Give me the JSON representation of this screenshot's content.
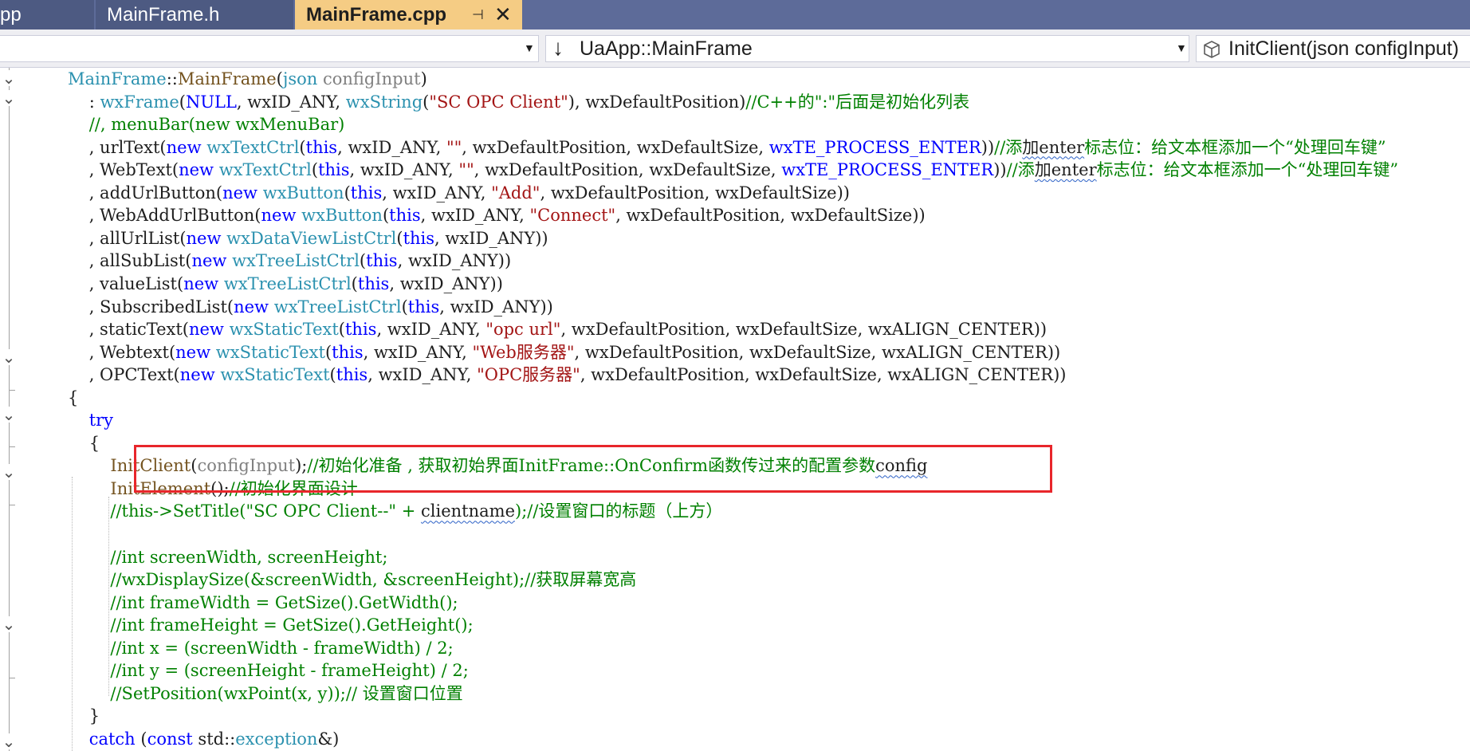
{
  "tabs": [
    {
      "label": "pp",
      "active": false
    },
    {
      "label": "MainFrame.h",
      "active": false
    },
    {
      "label": "MainFrame.cpp",
      "active": true
    }
  ],
  "tab_icons": {
    "pin": "pin-icon",
    "close": "close-icon"
  },
  "nav": {
    "scope_value": "",
    "type_value": "UaApp::MainFrame",
    "member_value": "InitClient(json configInput)"
  },
  "colors": {
    "tab_bar": "#5d6b99",
    "active_tab": "#f5cc84",
    "keyword": "#0000ff",
    "type": "#2b91af",
    "function": "#74531f",
    "string": "#a31515",
    "comment": "#008000",
    "highlight_box": "#e8262b"
  },
  "code_lines": [
    [
      [
        "t",
        "MainFrame"
      ],
      [
        "n",
        "::"
      ],
      [
        "m",
        "MainFrame"
      ],
      [
        "n",
        "("
      ],
      [
        "t",
        "json"
      ],
      [
        "n",
        " "
      ],
      [
        "p",
        "configInput"
      ],
      [
        "n",
        ")"
      ]
    ],
    [
      [
        "n",
        "    : "
      ],
      [
        "t",
        "wxFrame"
      ],
      [
        "n",
        "("
      ],
      [
        "k",
        "NULL"
      ],
      [
        "n",
        ", wxID_ANY, "
      ],
      [
        "t",
        "wxString"
      ],
      [
        "n",
        "("
      ],
      [
        "s",
        "\"SC OPC Client\""
      ],
      [
        "n",
        "), wxDefaultPosition)"
      ],
      [
        "c",
        "//C++的\":\"后面是初始化列表"
      ]
    ],
    [
      [
        "c",
        "    //, menuBar(new wxMenuBar)"
      ]
    ],
    [
      [
        "n",
        "    , urlText("
      ],
      [
        "k",
        "new"
      ],
      [
        "n",
        " "
      ],
      [
        "t",
        "wxTextCtrl"
      ],
      [
        "n",
        "("
      ],
      [
        "k",
        "this"
      ],
      [
        "n",
        ", wxID_ANY, "
      ],
      [
        "s",
        "\"\""
      ],
      [
        "n",
        ", wxDefaultPosition, wxDefaultSize, "
      ],
      [
        "k",
        "wxTE_PROCESS_ENTER"
      ],
      [
        "n",
        "))"
      ],
      [
        "c",
        "//添"
      ],
      [
        "sqc",
        "加enter"
      ],
      [
        "c",
        "标志位：给文本框添加一个“处理回车键”"
      ]
    ],
    [
      [
        "n",
        "    , WebText("
      ],
      [
        "k",
        "new"
      ],
      [
        "n",
        " "
      ],
      [
        "t",
        "wxTextCtrl"
      ],
      [
        "n",
        "("
      ],
      [
        "k",
        "this"
      ],
      [
        "n",
        ", wxID_ANY, "
      ],
      [
        "s",
        "\"\""
      ],
      [
        "n",
        ", wxDefaultPosition, wxDefaultSize, "
      ],
      [
        "k",
        "wxTE_PROCESS_ENTER"
      ],
      [
        "n",
        "))"
      ],
      [
        "c",
        "//添"
      ],
      [
        "sqc",
        "加enter"
      ],
      [
        "c",
        "标志位：给文本框添加一个“处理回车键”"
      ]
    ],
    [
      [
        "n",
        "    , addUrlButton("
      ],
      [
        "k",
        "new"
      ],
      [
        "n",
        " "
      ],
      [
        "t",
        "wxButton"
      ],
      [
        "n",
        "("
      ],
      [
        "k",
        "this"
      ],
      [
        "n",
        ", wxID_ANY, "
      ],
      [
        "s",
        "\"Add\""
      ],
      [
        "n",
        ", wxDefaultPosition, wxDefaultSize))"
      ]
    ],
    [
      [
        "n",
        "    , WebAddUrlButton("
      ],
      [
        "k",
        "new"
      ],
      [
        "n",
        " "
      ],
      [
        "t",
        "wxButton"
      ],
      [
        "n",
        "("
      ],
      [
        "k",
        "this"
      ],
      [
        "n",
        ", wxID_ANY, "
      ],
      [
        "s",
        "\"Connect\""
      ],
      [
        "n",
        ", wxDefaultPosition, wxDefaultSize))"
      ]
    ],
    [
      [
        "n",
        "    , allUrlList("
      ],
      [
        "k",
        "new"
      ],
      [
        "n",
        " "
      ],
      [
        "t",
        "wxDataViewListCtrl"
      ],
      [
        "n",
        "("
      ],
      [
        "k",
        "this"
      ],
      [
        "n",
        ", wxID_ANY))"
      ]
    ],
    [
      [
        "n",
        "    , allSubList("
      ],
      [
        "k",
        "new"
      ],
      [
        "n",
        " "
      ],
      [
        "t",
        "wxTreeListCtrl"
      ],
      [
        "n",
        "("
      ],
      [
        "k",
        "this"
      ],
      [
        "n",
        ", wxID_ANY))"
      ]
    ],
    [
      [
        "n",
        "    , valueList("
      ],
      [
        "k",
        "new"
      ],
      [
        "n",
        " "
      ],
      [
        "t",
        "wxTreeListCtrl"
      ],
      [
        "n",
        "("
      ],
      [
        "k",
        "this"
      ],
      [
        "n",
        ", wxID_ANY))"
      ]
    ],
    [
      [
        "n",
        "    , SubscribedList("
      ],
      [
        "k",
        "new"
      ],
      [
        "n",
        " "
      ],
      [
        "t",
        "wxTreeListCtrl"
      ],
      [
        "n",
        "("
      ],
      [
        "k",
        "this"
      ],
      [
        "n",
        ", wxID_ANY))"
      ]
    ],
    [
      [
        "n",
        "    , staticText("
      ],
      [
        "k",
        "new"
      ],
      [
        "n",
        " "
      ],
      [
        "t",
        "wxStaticText"
      ],
      [
        "n",
        "("
      ],
      [
        "k",
        "this"
      ],
      [
        "n",
        ", wxID_ANY, "
      ],
      [
        "s",
        "\"opc url\""
      ],
      [
        "n",
        ", wxDefaultPosition, wxDefaultSize, wxALIGN_CENTER))"
      ]
    ],
    [
      [
        "n",
        "    , Webtext("
      ],
      [
        "k",
        "new"
      ],
      [
        "n",
        " "
      ],
      [
        "t",
        "wxStaticText"
      ],
      [
        "n",
        "("
      ],
      [
        "k",
        "this"
      ],
      [
        "n",
        ", wxID_ANY, "
      ],
      [
        "s",
        "\"Web服务器\""
      ],
      [
        "n",
        ", wxDefaultPosition, wxDefaultSize, wxALIGN_CENTER))"
      ]
    ],
    [
      [
        "n",
        "    , OPCText("
      ],
      [
        "k",
        "new"
      ],
      [
        "n",
        " "
      ],
      [
        "t",
        "wxStaticText"
      ],
      [
        "n",
        "("
      ],
      [
        "k",
        "this"
      ],
      [
        "n",
        ", wxID_ANY, "
      ],
      [
        "s",
        "\"OPC服务器\""
      ],
      [
        "n",
        ", wxDefaultPosition, wxDefaultSize, wxALIGN_CENTER))"
      ]
    ],
    [
      [
        "n",
        "{"
      ]
    ],
    [
      [
        "n",
        "    "
      ],
      [
        "k",
        "try"
      ]
    ],
    [
      [
        "n",
        "    {"
      ]
    ],
    [
      [
        "n",
        "        "
      ],
      [
        "m",
        "InitClient"
      ],
      [
        "n",
        "("
      ],
      [
        "p",
        "configInput"
      ],
      [
        "n",
        ");"
      ],
      [
        "c",
        "//初始化准备 , 获取初始界面InitFrame::OnConfirm函数传过来的配置参数"
      ],
      [
        "sqc",
        "config"
      ]
    ],
    [
      [
        "n",
        "        "
      ],
      [
        "m",
        "InitElement"
      ],
      [
        "n",
        "();"
      ],
      [
        "c",
        "//初始化界面设计"
      ]
    ],
    [
      [
        "c",
        "        //this->SetTitle(\"SC OPC Client--\" + "
      ],
      [
        "sqc",
        "clientname"
      ],
      [
        "c",
        ");//设置窗口的标题（上方）"
      ]
    ],
    [
      [
        "n",
        ""
      ]
    ],
    [
      [
        "c",
        "        //int screenWidth, screenHeight;"
      ]
    ],
    [
      [
        "c",
        "        //wxDisplaySize(&screenWidth, &screenHeight);//获取屏幕宽高"
      ]
    ],
    [
      [
        "c",
        "        //int frameWidth = GetSize().GetWidth();"
      ]
    ],
    [
      [
        "c",
        "        //int frameHeight = GetSize().GetHeight();"
      ]
    ],
    [
      [
        "c",
        "        //int x = (screenWidth - frameWidth) / 2;"
      ]
    ],
    [
      [
        "c",
        "        //int y = (screenHeight - frameHeight) / 2;"
      ]
    ],
    [
      [
        "c",
        "        //SetPosition(wxPoint(x, y));// 设置窗口位置"
      ]
    ],
    [
      [
        "n",
        "    }"
      ]
    ],
    [
      [
        "n",
        "    "
      ],
      [
        "k",
        "catch"
      ],
      [
        "n",
        " ("
      ],
      [
        "k",
        "const"
      ],
      [
        "n",
        " std::"
      ],
      [
        "t",
        "exception"
      ],
      [
        "n",
        "&)"
      ]
    ]
  ]
}
